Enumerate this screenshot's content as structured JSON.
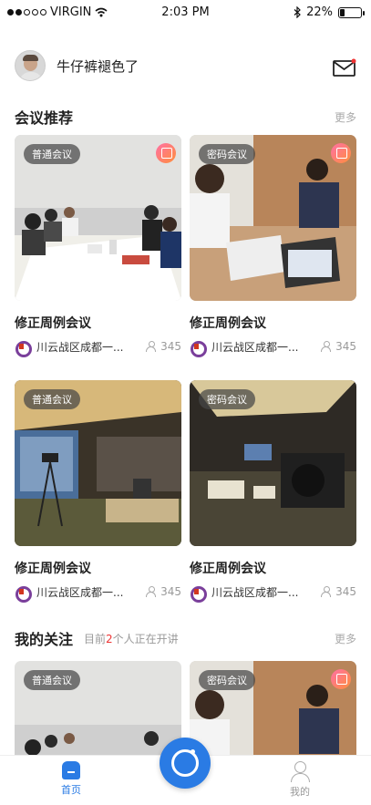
{
  "status_bar": {
    "carrier": "VIRGIN",
    "time": "2:03 PM",
    "battery": "22%",
    "battery_level": 0.22
  },
  "header": {
    "username": "牛仔裤褪色了",
    "mail_icon": "mail-icon"
  },
  "recommend": {
    "title": "会议推荐",
    "more": "更多",
    "cards": [
      {
        "tag": "普通会议",
        "title": "修正周例会议",
        "org": "川云战区成都一...",
        "count": "345"
      },
      {
        "tag": "密码会议",
        "title": "修正周例会议",
        "org": "川云战区成都一...",
        "count": "345"
      },
      {
        "tag": "普通会议",
        "title": "修正周例会议",
        "org": "川云战区成都一...",
        "count": "345"
      },
      {
        "tag": "密码会议",
        "title": "修正周例会议",
        "org": "川云战区成都一...",
        "count": "345"
      }
    ]
  },
  "following": {
    "title": "我的关注",
    "sub_prefix": "目前",
    "sub_count": "2",
    "sub_suffix": "个人正在开讲",
    "more": "更多",
    "cards": [
      {
        "tag": "普通会议"
      },
      {
        "tag": "密码会议"
      }
    ]
  },
  "tab_bar": {
    "home": "首页",
    "mine": "我的",
    "accent": "#2a7be4"
  }
}
